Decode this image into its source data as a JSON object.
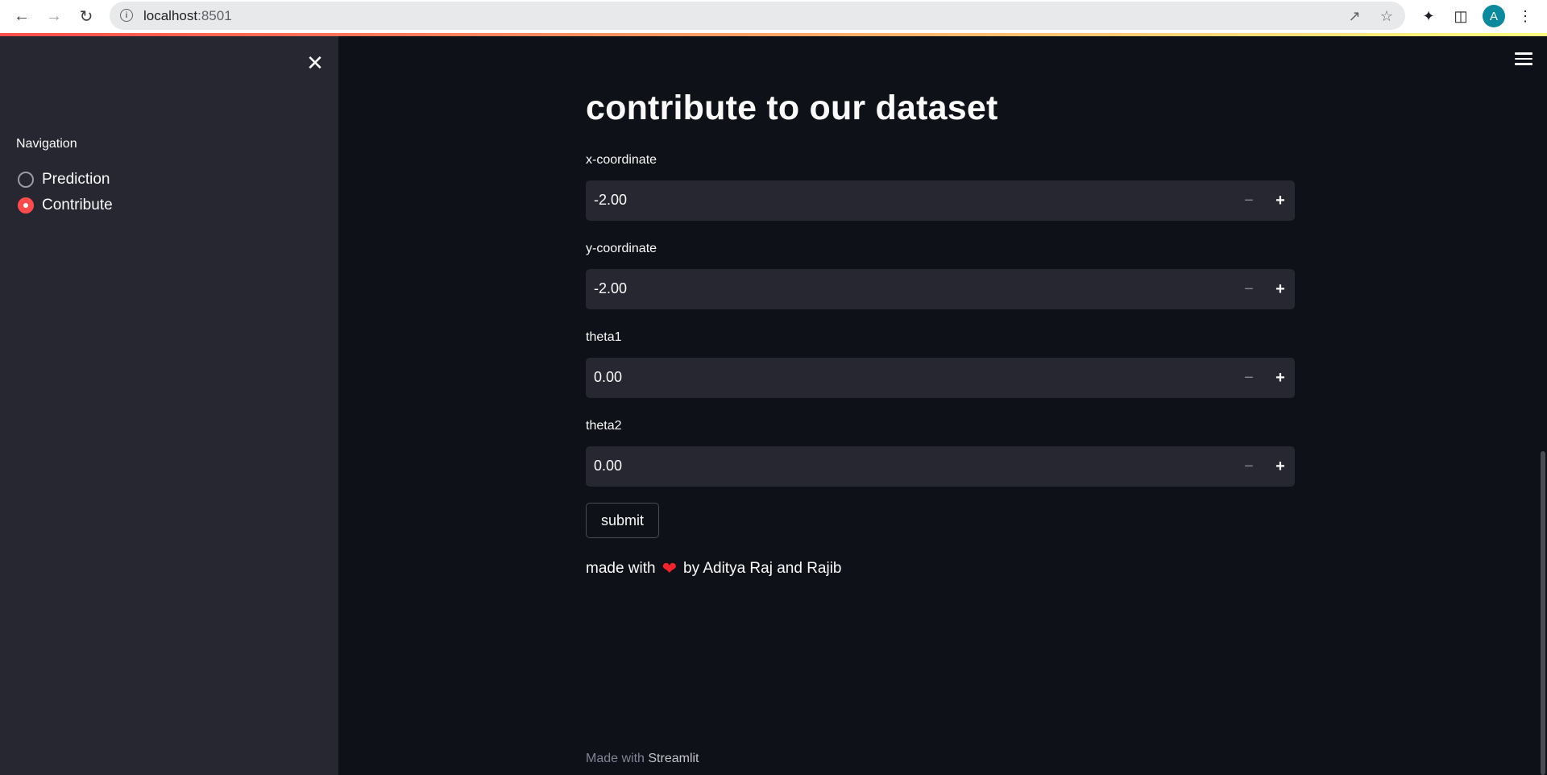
{
  "browser": {
    "url_host": "localhost",
    "url_port": ":8501",
    "avatar_letter": "A"
  },
  "sidebar": {
    "nav_heading": "Navigation",
    "options": [
      {
        "label": "Prediction",
        "selected": false
      },
      {
        "label": "Contribute",
        "selected": true
      }
    ]
  },
  "main": {
    "title": "contribute to our dataset",
    "fields": [
      {
        "label": "x-coordinate",
        "value": "-2.00"
      },
      {
        "label": "y-coordinate",
        "value": "-2.00"
      },
      {
        "label": "theta1",
        "value": "0.00"
      },
      {
        "label": "theta2",
        "value": "0.00"
      }
    ],
    "submit_label": "submit",
    "credit_prefix": "made with",
    "credit_suffix": "by Aditya Raj and Rajib"
  },
  "footer": {
    "prefix": "Made with ",
    "brand": "Streamlit"
  },
  "colors": {
    "accent": "#ff4b4b",
    "background": "#0e1117",
    "sidebar": "#262730"
  }
}
